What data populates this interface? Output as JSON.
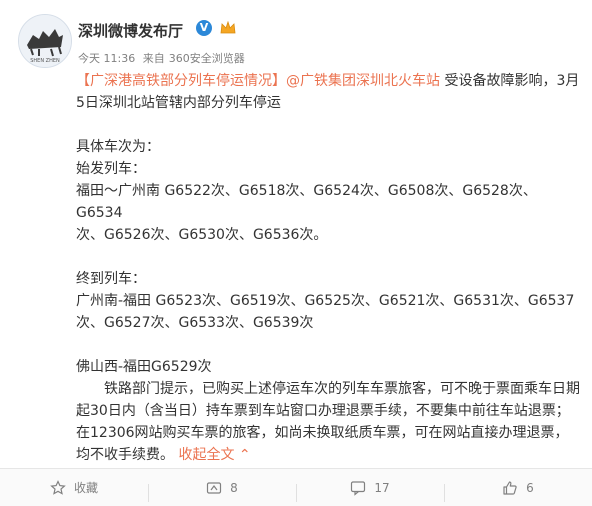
{
  "post": {
    "author": "深圳微博发布厅",
    "time": "今天 11:36",
    "source_prefix": "来自",
    "source": "360安全浏览器",
    "title_link": "【广深港高铁部分列车停运情况】",
    "mention": "@广铁集团深圳北火车站",
    "title_rest": " 受设备故障影响，3月5日深圳北站管辖内部分列车停运",
    "section_label": "具体车次为：",
    "origin_label": "始发列车：",
    "origin_line1": "福田～广州南 G6522次、G6518次、G6524次、G6508次、G6528次、G6534",
    "origin_line2": "次、G6526次、G6530次、G6536次。",
    "terminal_label": "终到列车：",
    "terminal_line1": "广州南-福田 G6523次、G6519次、G6525次、G6521次、G6531次、G6537",
    "terminal_line2": "次、G6527次、G6533次、G6539次",
    "foshan_line": "佛山西-福田G6529次",
    "notice_line1": "铁路部门提示，已购买上述停运车次的列车车票旅客，可不晚于票面乘车日期",
    "notice_line2": "起30日内（含当日）持车票到车站窗口办理退票手续，不要集中前往车站退票；",
    "notice_line3": "在12306网站购买车票的旅客，如尚未换取纸质车票，可在网站直接办理退票，",
    "notice_line4": "均不收手续费。",
    "collapse_label": "收起全文",
    "collapse_arrow": "⌃"
  },
  "footer": {
    "favorite_label": "收藏",
    "repost_count": "8",
    "comment_count": "17",
    "like_count": "6"
  },
  "colors": {
    "link": "#eb7350",
    "verify": "#2c88d8",
    "meta": "#808080"
  },
  "icons": [
    "avatar-horse-logo",
    "verified-icon",
    "crown-icon",
    "favorite-star-icon",
    "repost-icon",
    "comment-icon",
    "like-thumb-icon"
  ]
}
